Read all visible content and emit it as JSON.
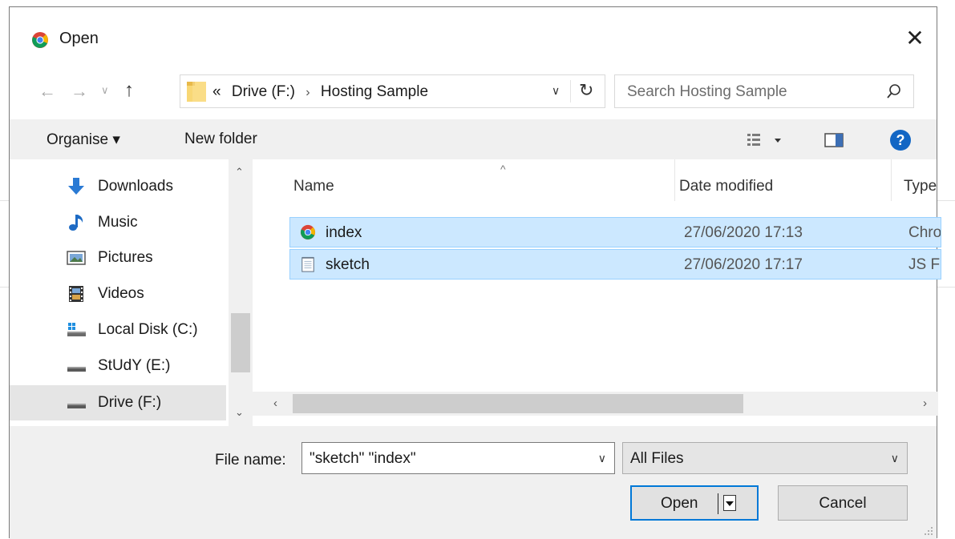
{
  "dialog": {
    "title": "Open",
    "close_glyph": "✕"
  },
  "nav": {
    "back_glyph": "←",
    "forward_glyph": "→",
    "recent_glyph": "∨",
    "up_glyph": "↑",
    "breadcrumb_prefix": "«",
    "breadcrumbs": [
      "Drive (F:)",
      "Hosting Sample"
    ],
    "crumb_sep": "›",
    "dropdown_glyph": "∨",
    "refresh_glyph": "↻"
  },
  "search": {
    "placeholder": "Search Hosting Sample"
  },
  "toolbar": {
    "organise_label": "Organise ▾",
    "new_folder_label": "New folder",
    "help_label": "?"
  },
  "sidebar": {
    "items": [
      {
        "label": "Downloads",
        "icon": "downloads-icon"
      },
      {
        "label": "Music",
        "icon": "music-icon"
      },
      {
        "label": "Pictures",
        "icon": "pictures-icon"
      },
      {
        "label": "Videos",
        "icon": "videos-icon"
      },
      {
        "label": "Local Disk (C:)",
        "icon": "local-disk-icon"
      },
      {
        "label": "StUdY (E:)",
        "icon": "drive-icon"
      },
      {
        "label": "Drive (F:)",
        "icon": "drive-icon",
        "selected": true
      }
    ]
  },
  "file_list": {
    "columns": [
      "Name",
      "Date modified",
      "Type"
    ],
    "rows": [
      {
        "name": "index",
        "date": "27/06/2020 17:13",
        "type": "Chro",
        "icon": "chrome-icon",
        "selected": true
      },
      {
        "name": "sketch",
        "date": "27/06/2020 17:17",
        "type": "JS Fil",
        "icon": "text-file-icon",
        "selected": true
      }
    ]
  },
  "footer": {
    "file_name_label": "File name:",
    "file_name_value": "\"sketch\" \"index\"",
    "file_type_value": "All Files",
    "open_label": "Open",
    "cancel_label": "Cancel"
  },
  "colors": {
    "selection_bg": "#cce8ff",
    "selection_border": "#99d1ff",
    "accent": "#0078d7",
    "toolbar_bg": "#f0f0f0"
  }
}
